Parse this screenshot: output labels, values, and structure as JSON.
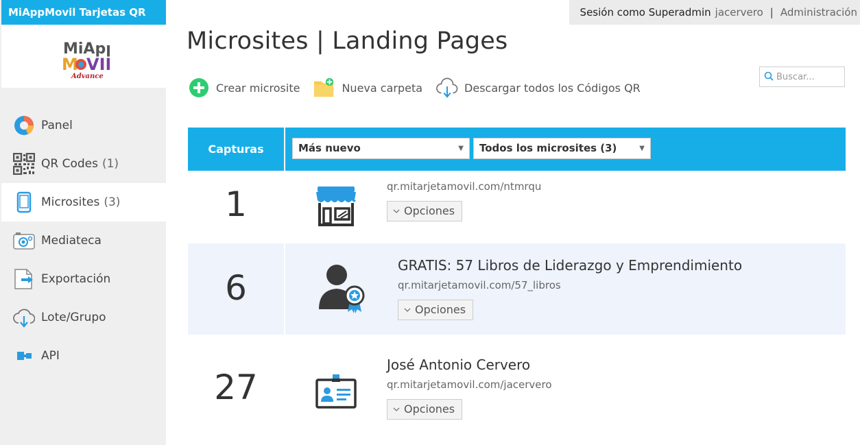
{
  "app": {
    "brand": "MiAppMovil Tarjetas QR",
    "logo_alt": "MiApp MOVIL Advance"
  },
  "session": {
    "label": "Sesión como Superadmin",
    "user": "jacervero",
    "separator": "|",
    "admin_link": "Administración"
  },
  "sidebar": {
    "items": [
      {
        "label": "Panel",
        "count": "",
        "icon": "pie-chart-icon"
      },
      {
        "label": "QR Codes",
        "count": "(1)",
        "icon": "qr-code-icon"
      },
      {
        "label": "Microsites",
        "count": "(3)",
        "icon": "mobile-phone-icon"
      },
      {
        "label": "Mediateca",
        "count": "",
        "icon": "camera-icon"
      },
      {
        "label": "Exportación",
        "count": "",
        "icon": "export-icon"
      },
      {
        "label": "Lote/Grupo",
        "count": "",
        "icon": "cloud-download-icon"
      },
      {
        "label": "API",
        "count": "",
        "icon": "api-icon"
      }
    ]
  },
  "page": {
    "title": "Microsites | Landing Pages"
  },
  "actions": {
    "create": "Crear microsite",
    "new_folder": "Nueva carpeta",
    "download_all": "Descargar todos los Códigos QR"
  },
  "search": {
    "placeholder": "Buscar..."
  },
  "table": {
    "captures_header": "Capturas",
    "sort_select": "Más nuevo",
    "filter_select": "Todos los microsites (3)",
    "options_label": "Opciones",
    "rows": [
      {
        "captures": "1",
        "name": "",
        "url": "qr.mitarjetamovil.com/ntmrqu",
        "icon": "store-icon"
      },
      {
        "captures": "6",
        "name": "GRATIS: 57 Libros de Liderazgo y Emprendimiento",
        "url": "qr.mitarjetamovil.com/57_libros",
        "icon": "user-award-icon"
      },
      {
        "captures": "27",
        "name": "José Antonio Cervero",
        "url": "qr.mitarjetamovil.com/jacervero",
        "icon": "id-card-icon"
      }
    ]
  },
  "colors": {
    "accent": "#17aee8",
    "sidebar_bg": "#efefef",
    "highlight_row": "#eef3fc",
    "create_green": "#2ecc71",
    "folder_yellow": "#f7cb4d"
  }
}
